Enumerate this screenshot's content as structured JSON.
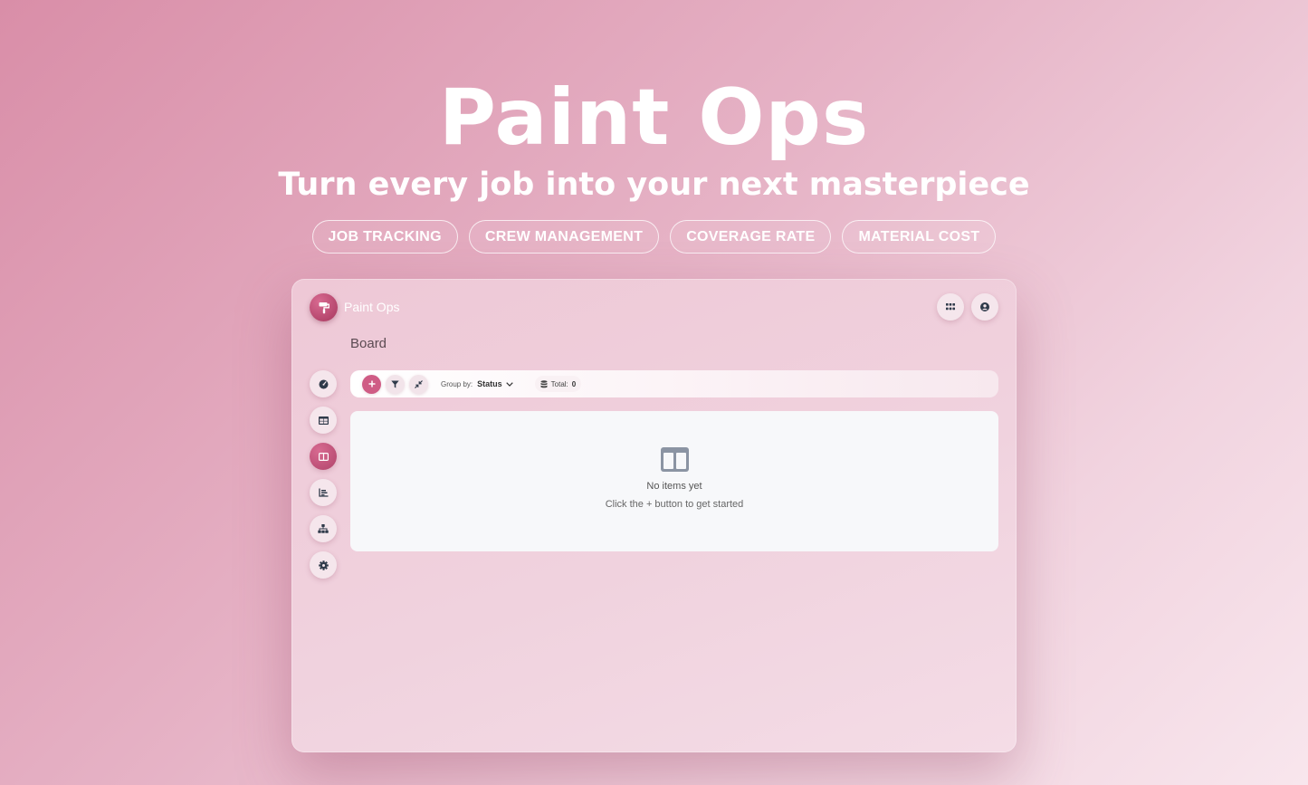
{
  "hero": {
    "title": "Paint Ops",
    "subtitle": "Turn every job into your next masterpiece",
    "tags": [
      "JOB TRACKING",
      "CREW MANAGEMENT",
      "COVERAGE RATE",
      "MATERIAL COST"
    ]
  },
  "app": {
    "brand": "Paint Ops",
    "page_title": "Board",
    "top_actions": [
      "apps-grid-icon",
      "user-account-icon"
    ],
    "sidebar": [
      {
        "icon": "dashboard-gauge-icon",
        "active": false
      },
      {
        "icon": "table-icon",
        "active": false
      },
      {
        "icon": "board-columns-icon",
        "active": true
      },
      {
        "icon": "bar-chart-icon",
        "active": false
      },
      {
        "icon": "hierarchy-icon",
        "active": false
      },
      {
        "icon": "gear-icon",
        "active": false
      }
    ],
    "toolbar": {
      "group_by_label": "Group by:",
      "group_by_value": "Status",
      "total_label": "Total:",
      "total_value": "0"
    },
    "empty_state": {
      "title": "No items yet",
      "hint": "Click the + button to get started"
    },
    "colors": {
      "accent": "#cf5c85",
      "icon_dark": "#2f3a4a"
    }
  }
}
